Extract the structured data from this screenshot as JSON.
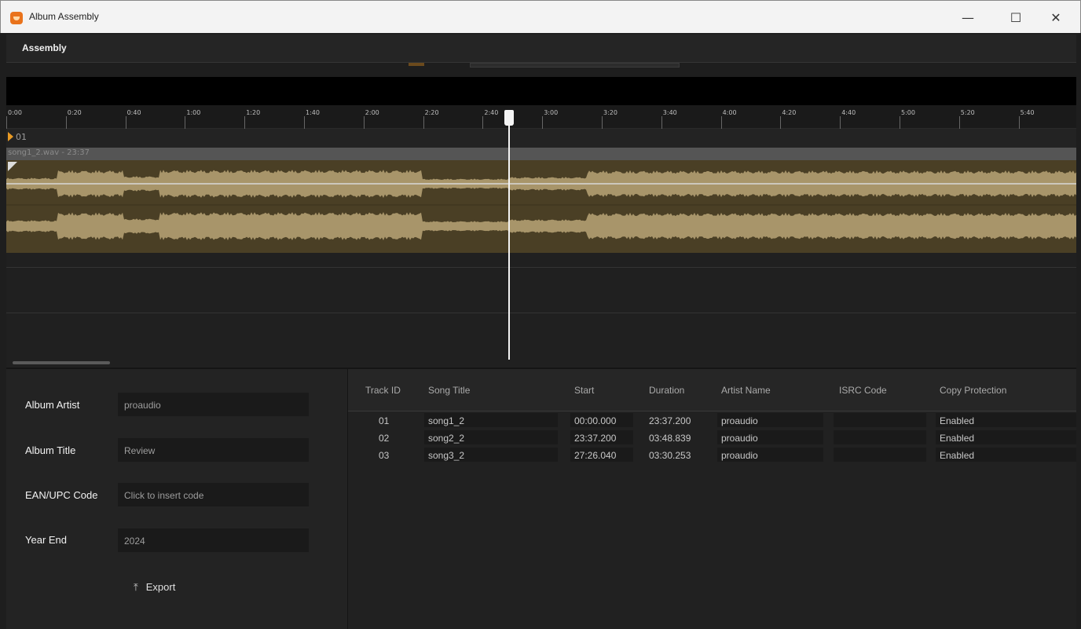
{
  "window": {
    "title": "Album Assembly",
    "minimize": "—",
    "maximize": "☐",
    "close": "✕"
  },
  "menu": {
    "items": [
      "Assembly"
    ]
  },
  "timeline": {
    "ticks": [
      "0:00",
      "0:20",
      "0:40",
      "1:00",
      "1:20",
      "1:40",
      "2:00",
      "2:20",
      "2:40",
      "3:00",
      "3:20",
      "3:40",
      "4:00",
      "4:20",
      "4:40",
      "5:00",
      "5:20",
      "5:40"
    ],
    "playhead": "2:44"
  },
  "track": {
    "marker_label": "01",
    "clip_name": "song1_2.wav - 23:37"
  },
  "album": {
    "artist_label": "Album Artist",
    "artist_value": "proaudio",
    "title_label": "Album Title",
    "title_value": "Review",
    "ean_label": "EAN/UPC Code",
    "ean_placeholder": "Click to insert code",
    "year_label": "Year End",
    "year_value": "2024",
    "export_label": "Export",
    "export_icon": "export-icon"
  },
  "table": {
    "headers": [
      "Track ID",
      "Song Title",
      "Start",
      "Duration",
      "Artist Name",
      "ISRC Code",
      "Copy Protection"
    ],
    "rows": [
      [
        "01",
        "song1_2",
        "00:00.000",
        "23:37.200",
        "proaudio",
        "",
        "Enabled"
      ],
      [
        "02",
        "song2_2",
        "23:37.200",
        "03:48.839",
        "proaudio",
        "",
        "Enabled"
      ],
      [
        "03",
        "song3_2",
        "27:26.040",
        "03:30.253",
        "proaudio",
        "",
        "Enabled"
      ]
    ]
  },
  "colors": {
    "accent": "#e89a24",
    "waveform_bg": "#4a3f25",
    "waveform_fill": "#a8956a",
    "background": "#1e1e1e"
  }
}
